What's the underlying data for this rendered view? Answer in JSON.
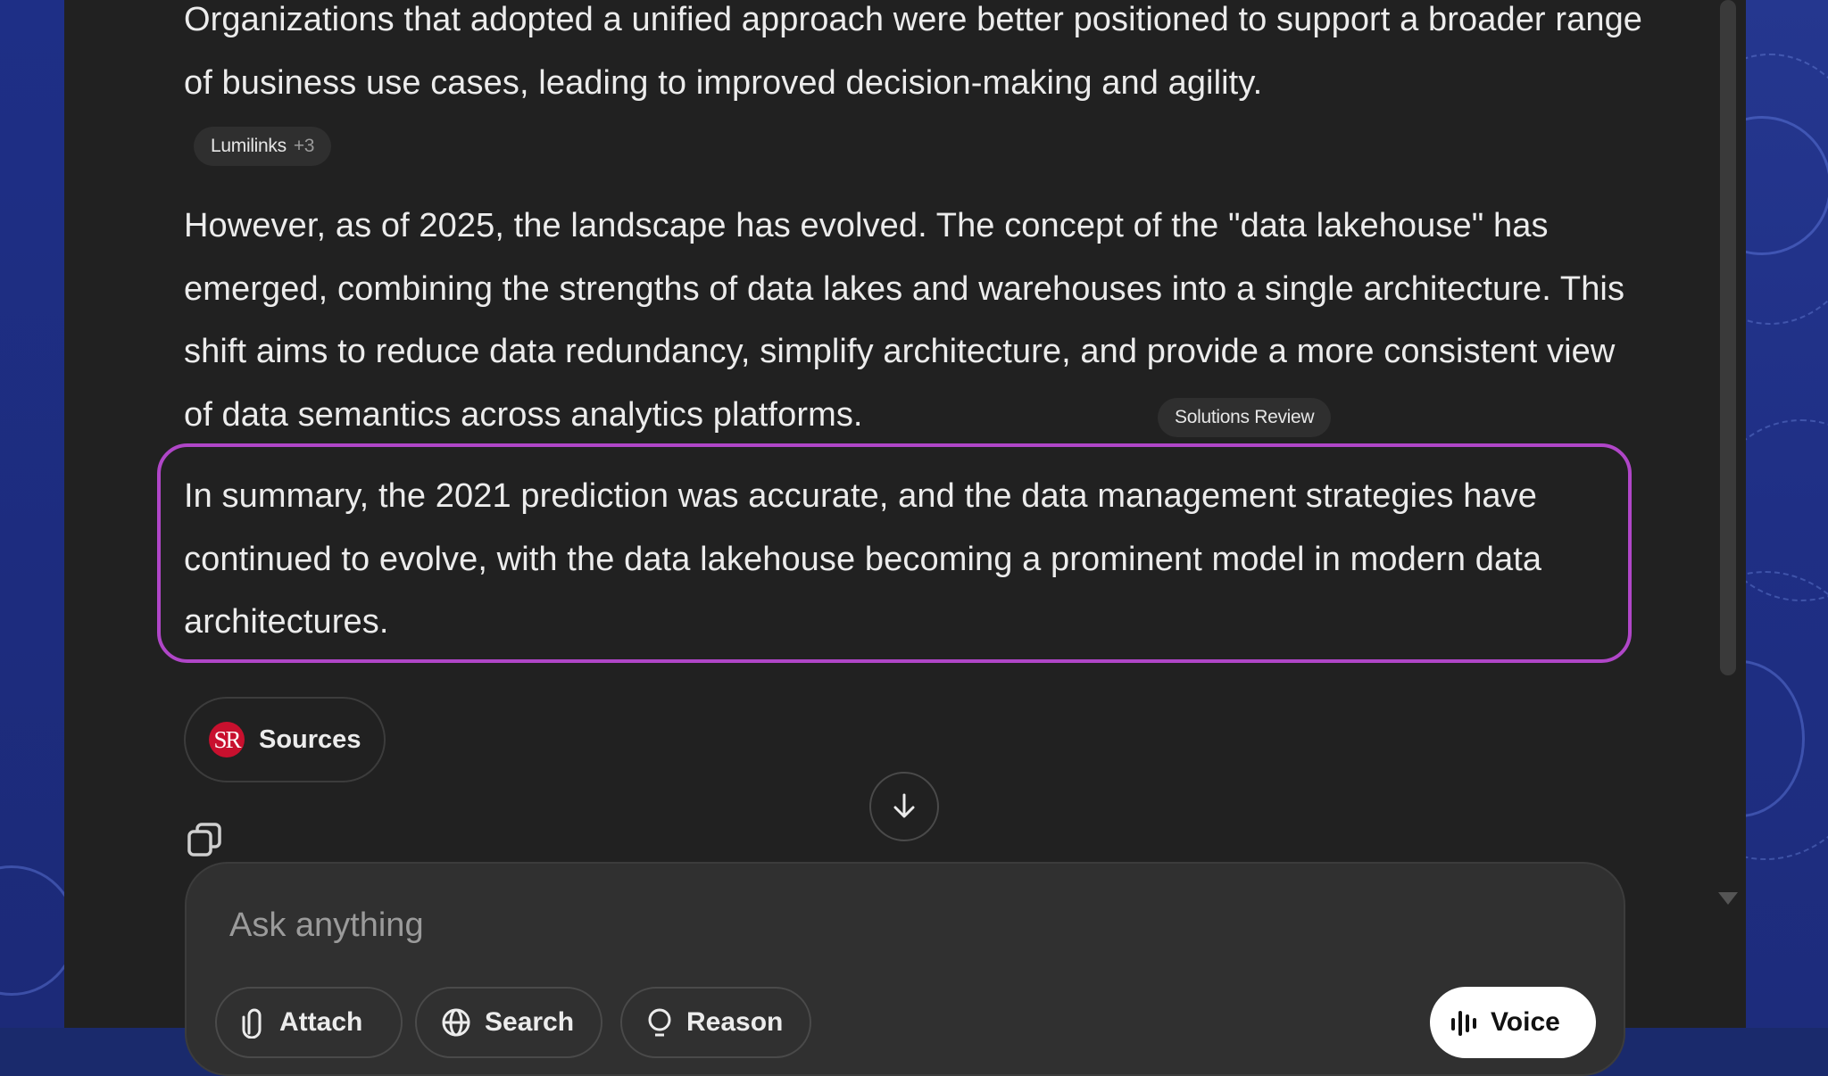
{
  "colors": {
    "panel_bg": "#212121",
    "text": "#ececec",
    "highlight_border": "#b046c8",
    "chip_bg": "#2f2f2f",
    "background_blue": "#1e2f86",
    "sr_logo_red": "#c8102e"
  },
  "conversation": {
    "paragraph_1": "Organizations that adopted a unified approach were better positioned to support a broader range of business use cases, leading to improved decision-making and agility.",
    "citation_1": {
      "label": "Lumilinks",
      "more": "+3"
    },
    "paragraph_2": "However, as of 2025, the landscape has evolved. The concept of the \"data lakehouse\" has emerged, combining the strengths of data lakes and warehouses into a single architecture. This shift aims to reduce data redundancy, simplify architecture, and provide a more consistent view of data semantics across analytics platforms.",
    "citation_2": {
      "label": "Solutions Review"
    },
    "paragraph_3": "In summary, the 2021 prediction was accurate, and the data management strategies have continued to evolve, with the data lakehouse becoming a prominent model in modern data architectures."
  },
  "sources": {
    "logo_text": "SR",
    "label": "Sources"
  },
  "icons": {
    "scroll_down": "arrow-down-icon",
    "copy": "copy-icon",
    "attach": "paperclip-icon",
    "search": "globe-icon",
    "reason": "lightbulb-icon",
    "voice": "waveform-icon"
  },
  "composer": {
    "placeholder": "Ask anything",
    "attach_label": "Attach",
    "search_label": "Search",
    "reason_label": "Reason",
    "voice_label": "Voice"
  }
}
